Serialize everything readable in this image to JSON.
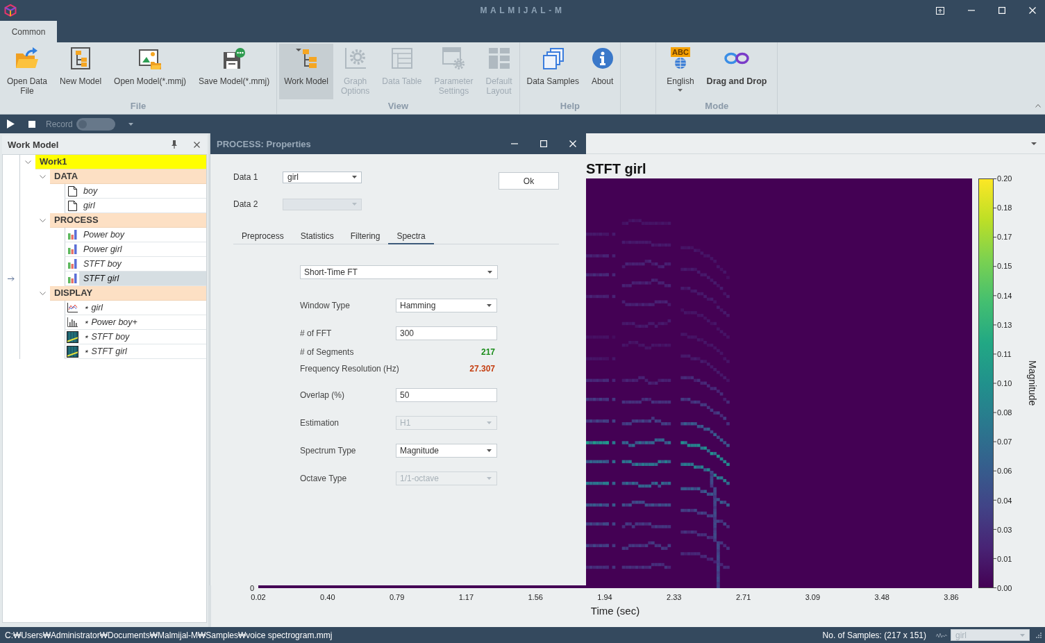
{
  "window": {
    "title": "MALMIJAL-M"
  },
  "ribbon": {
    "tabs": [
      {
        "label": "Common",
        "selected": true
      }
    ],
    "groups": [
      {
        "label": "File",
        "buttons": [
          {
            "label": "Open Data\nFile",
            "kind": "plain",
            "disabled": false,
            "pressed": false
          },
          {
            "label": "New Model",
            "kind": "plain",
            "disabled": false,
            "pressed": false
          },
          {
            "label": "Open Model(*.mmj)",
            "kind": "plain",
            "disabled": false,
            "pressed": false
          },
          {
            "label": "Save Model(*.mmj)",
            "kind": "plain",
            "disabled": false,
            "pressed": false
          }
        ]
      },
      {
        "label": "View",
        "buttons": [
          {
            "label": "Work Model",
            "kind": "plain",
            "disabled": false,
            "pressed": true
          },
          {
            "label": "Graph\nOptions",
            "kind": "plain",
            "disabled": true,
            "pressed": false
          },
          {
            "label": "Data Table",
            "kind": "plain",
            "disabled": true,
            "pressed": false
          },
          {
            "label": "Parameter\nSettings",
            "kind": "plain",
            "disabled": true,
            "pressed": false
          },
          {
            "label": "Default\nLayout",
            "kind": "plain",
            "disabled": true,
            "pressed": false
          }
        ]
      },
      {
        "label": "Help",
        "buttons": [
          {
            "label": "Data Samples",
            "kind": "plain",
            "disabled": false,
            "pressed": false
          },
          {
            "label": "About",
            "kind": "plain",
            "disabled": false,
            "pressed": false
          }
        ]
      },
      {
        "label": "Mode",
        "buttons": [
          {
            "label": "English",
            "kind": "dropdown",
            "badge": "ABC",
            "disabled": false,
            "pressed": false
          },
          {
            "label": "Drag and Drop",
            "kind": "emphasis",
            "disabled": false,
            "pressed": false
          }
        ]
      }
    ]
  },
  "toolbar": {
    "record": {
      "label": "Record",
      "on": false
    }
  },
  "work_model": {
    "title": "Work Model",
    "tree": [
      {
        "label": "Work1",
        "kind": "root",
        "expanded": true,
        "selected": false,
        "children": [
          {
            "label": "DATA",
            "kind": "group",
            "expanded": true,
            "selected": false,
            "children": [
              {
                "label": "boy",
                "kind": "data",
                "selected": false
              },
              {
                "label": "girl",
                "kind": "data",
                "selected": false
              }
            ]
          },
          {
            "label": "PROCESS",
            "kind": "group",
            "expanded": true,
            "selected": false,
            "children": [
              {
                "label": "Power boy",
                "kind": "process",
                "selected": false
              },
              {
                "label": "Power girl",
                "kind": "process",
                "selected": false
              },
              {
                "label": "STFT boy",
                "kind": "process",
                "selected": false
              },
              {
                "label": "STFT girl",
                "kind": "process",
                "selected": true
              }
            ]
          },
          {
            "label": "DISPLAY",
            "kind": "group",
            "expanded": true,
            "selected": false,
            "children": [
              {
                "label": "⋆ girl",
                "kind": "line-plot",
                "selected": false
              },
              {
                "label": "⋆ Power boy+",
                "kind": "bar-plot",
                "selected": false
              },
              {
                "label": "⋆ STFT boy",
                "kind": "image-plot",
                "selected": false
              },
              {
                "label": "⋆ STFT girl",
                "kind": "image-plot",
                "selected": false
              }
            ]
          }
        ]
      }
    ]
  },
  "dialog": {
    "title": "PROCESS: Properties",
    "sources": [
      {
        "label": "Data 1",
        "value": "girl",
        "disabled": false
      },
      {
        "label": "Data 2",
        "disabled": true
      }
    ],
    "ok": "Ok",
    "tabs": [
      {
        "label": "Preprocess",
        "selected": false
      },
      {
        "label": "Statistics",
        "selected": false
      },
      {
        "label": "Filtering",
        "selected": false
      },
      {
        "label": "Spectra",
        "selected": true
      }
    ],
    "method": {
      "value": "Short-Time FT",
      "disabled": false
    },
    "fields": [
      {
        "kind": "dropdown",
        "label": "Window Type",
        "value": "Hamming",
        "disabled": false
      },
      {
        "kind": "input",
        "label": "# of FFT",
        "value": "300",
        "disabled": false
      },
      {
        "kind": "readout",
        "label": "# of Segments",
        "value": "217",
        "color": "#1a8c1a",
        "disabled": false
      },
      {
        "kind": "readout",
        "label": "Frequency Resolution (Hz)",
        "value": "27.307",
        "color": "#c43e10",
        "disabled": false
      },
      {
        "kind": "input",
        "label": "Overlap (%)",
        "value": "50",
        "disabled": false
      },
      {
        "kind": "dropdown",
        "label": "Estimation",
        "value": "H1",
        "disabled": true
      },
      {
        "kind": "dropdown",
        "label": "Spectrum Type",
        "value": "Magnitude",
        "disabled": false
      },
      {
        "kind": "dropdown",
        "label": "Octave Type",
        "value": "1/1-octave",
        "disabled": true
      }
    ]
  },
  "chart": {
    "title": "STFT girl",
    "y_ticks": [
      "0"
    ],
    "x_ticks": [
      "0.02",
      "0.40",
      "0.79",
      "1.17",
      "1.56",
      "1.94",
      "2.33",
      "2.71",
      "3.09",
      "3.48",
      "3.86"
    ],
    "x_label": "Time (sec)",
    "colorbar": {
      "label": "Magnitude",
      "ticks": [
        "0.20",
        "0.18",
        "0.17",
        "0.15",
        "0.14",
        "0.13",
        "0.11",
        "0.10",
        "0.08",
        "0.07",
        "0.06",
        "0.04",
        "0.03",
        "0.01",
        "0.00"
      ]
    }
  },
  "status_bar": {
    "path": "C:₩Users₩Administrator₩Documents₩Malmijal-M₩Samples₩voice spectrogram.mmj",
    "samples": "No. of Samples: (217 x 151)",
    "channel": {
      "value": "girl",
      "disabled": true
    }
  }
}
